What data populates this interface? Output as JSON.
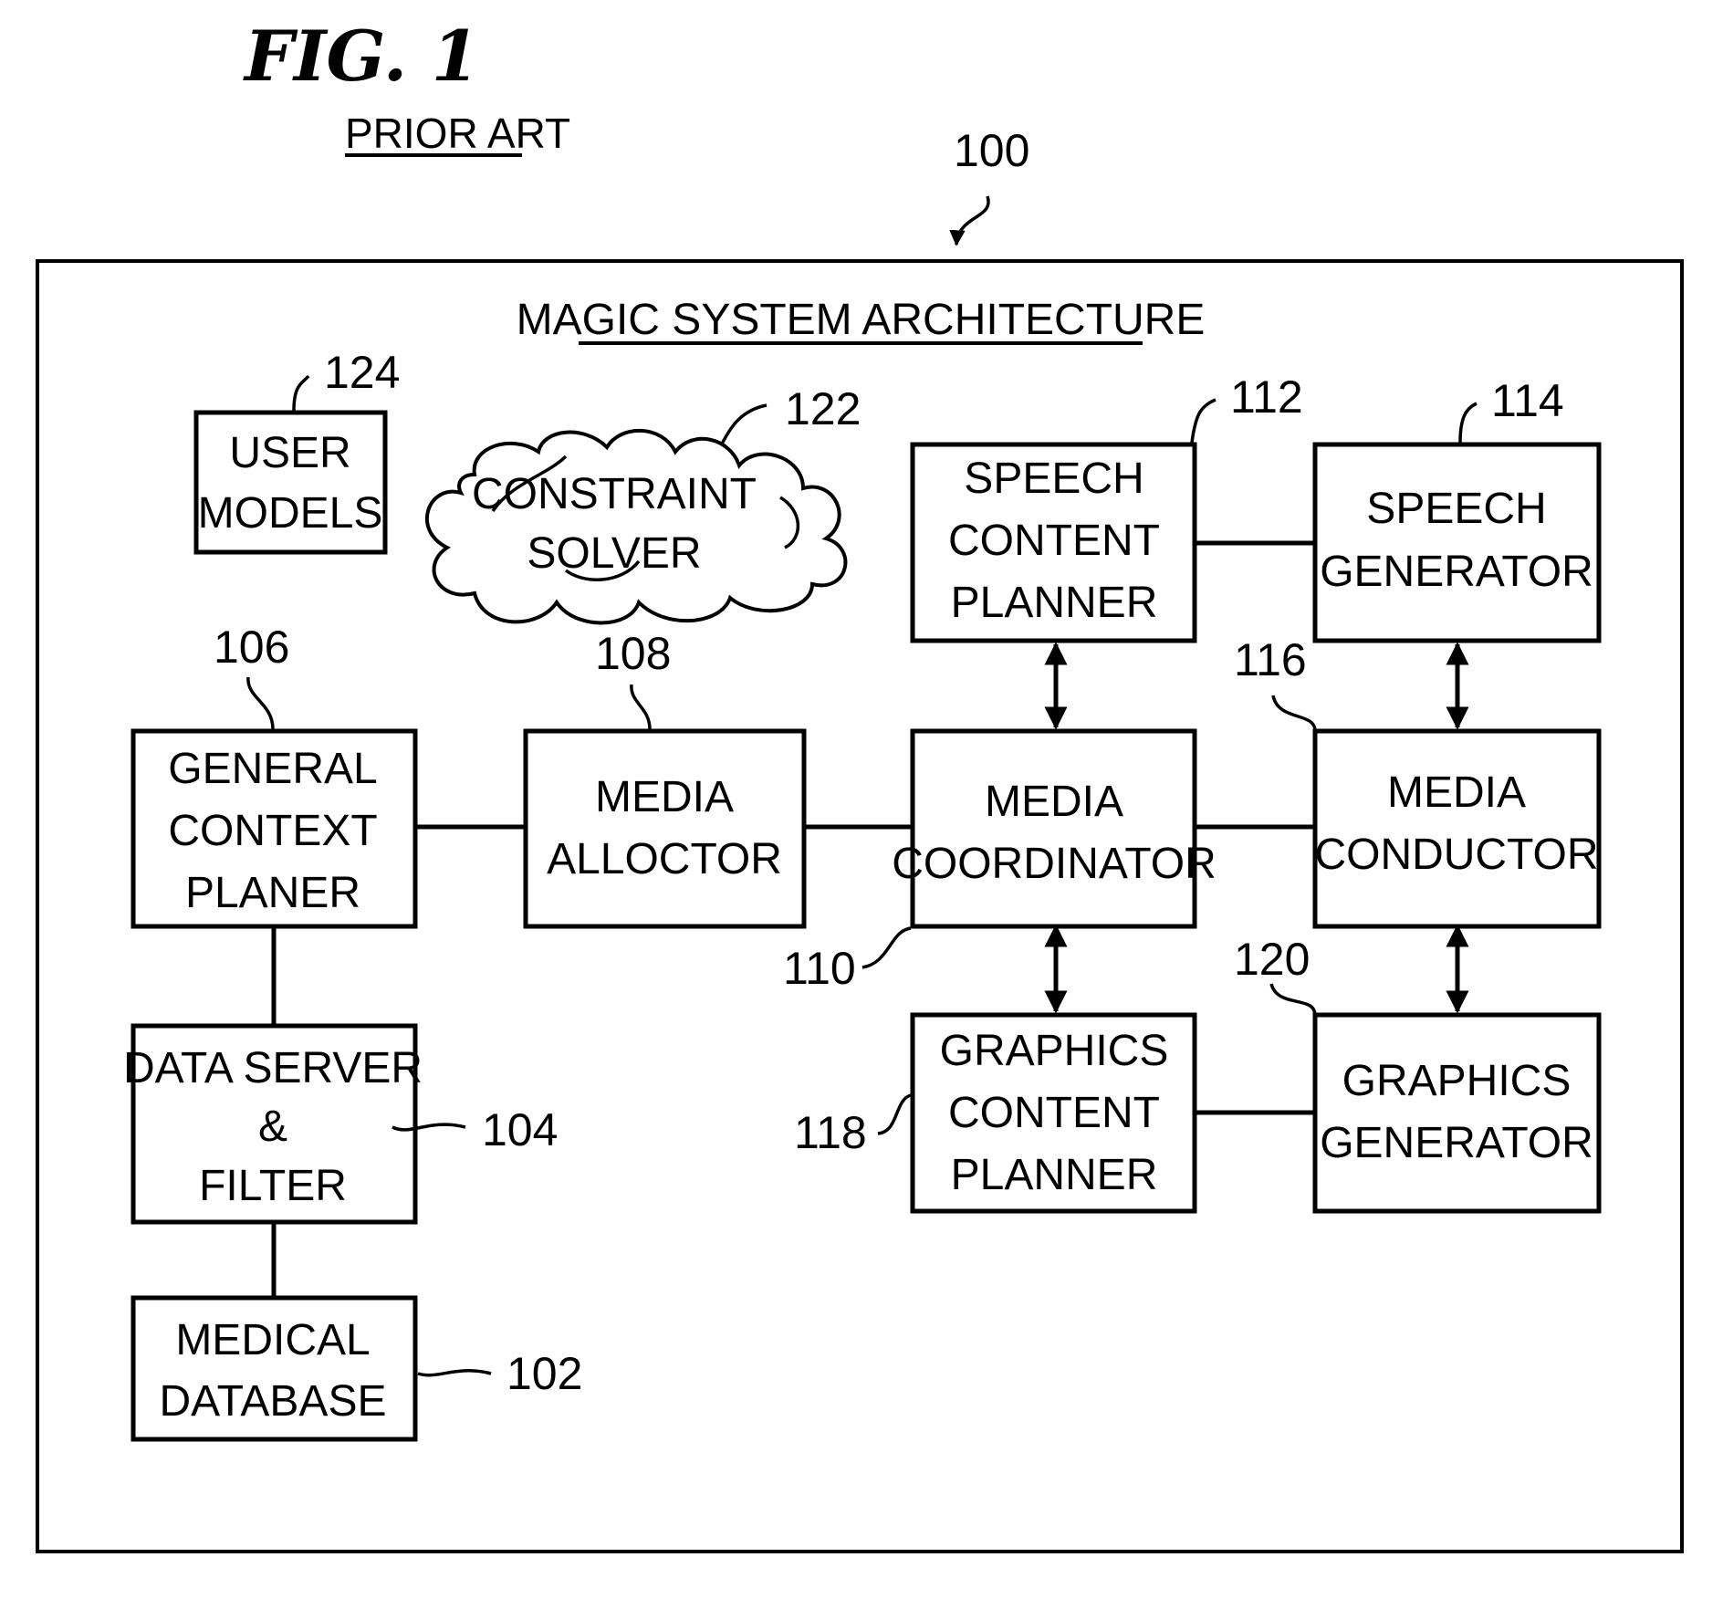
{
  "figure": {
    "title": "FIG. 1",
    "subtitle": "PRIOR ART",
    "reference": "100"
  },
  "diagram": {
    "title": "MAGIC SYSTEM ARCHITECTURE",
    "nodes": {
      "user_models": {
        "ref": "124",
        "lines": [
          "USER",
          "MODELS"
        ]
      },
      "constraint_solver": {
        "ref": "122",
        "lines": [
          "CONSTRAINT",
          "SOLVER"
        ]
      },
      "speech_content_planner": {
        "ref": "112",
        "lines": [
          "SPEECH",
          "CONTENT",
          "PLANNER"
        ]
      },
      "speech_generator": {
        "ref": "114",
        "lines": [
          "SPEECH",
          "GENERATOR"
        ]
      },
      "general_context_planer": {
        "ref": "106",
        "lines": [
          "GENERAL",
          "CONTEXT",
          "PLANER"
        ]
      },
      "media_allocator": {
        "ref": "108",
        "lines": [
          "MEDIA",
          "ALLOCTOR"
        ]
      },
      "media_coordinator": {
        "ref": "110",
        "lines": [
          "MEDIA",
          "COORDINATOR"
        ]
      },
      "media_conductor": {
        "ref": "116",
        "lines": [
          "MEDIA",
          "CONDUCTOR"
        ]
      },
      "data_server_filter": {
        "ref": "104",
        "lines": [
          "DATA  SERVER",
          "&",
          "FILTER"
        ]
      },
      "graphics_content_planner": {
        "ref": "118",
        "lines": [
          "GRAPHICS",
          "CONTENT",
          "PLANNER"
        ]
      },
      "graphics_generator": {
        "ref": "120",
        "lines": [
          "GRAPHICS",
          "GENERATOR"
        ]
      },
      "medical_database": {
        "ref": "102",
        "lines": [
          "MEDICAL",
          "DATABASE"
        ]
      }
    },
    "connections": [
      {
        "from": "general_context_planer",
        "to": "media_allocator",
        "type": "line"
      },
      {
        "from": "media_allocator",
        "to": "media_coordinator",
        "type": "line"
      },
      {
        "from": "media_coordinator",
        "to": "media_conductor",
        "type": "line"
      },
      {
        "from": "speech_content_planner",
        "to": "speech_generator",
        "type": "line"
      },
      {
        "from": "graphics_content_planner",
        "to": "graphics_generator",
        "type": "line"
      },
      {
        "from": "speech_content_planner",
        "to": "media_coordinator",
        "type": "bidirectional-arrow"
      },
      {
        "from": "media_coordinator",
        "to": "graphics_content_planner",
        "type": "bidirectional-arrow"
      },
      {
        "from": "speech_generator",
        "to": "media_conductor",
        "type": "bidirectional-arrow"
      },
      {
        "from": "media_conductor",
        "to": "graphics_generator",
        "type": "bidirectional-arrow"
      },
      {
        "from": "general_context_planer",
        "to": "data_server_filter",
        "type": "line"
      },
      {
        "from": "data_server_filter",
        "to": "medical_database",
        "type": "line"
      }
    ]
  }
}
